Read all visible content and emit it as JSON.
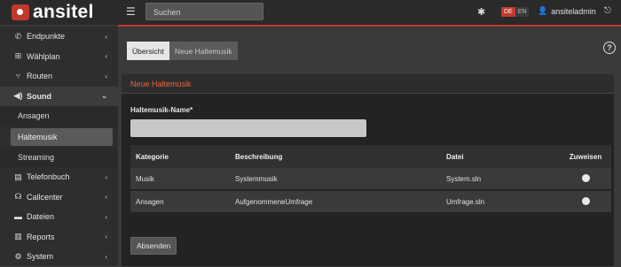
{
  "header": {
    "brand": "ansitel",
    "search_placeholder": "Suchen",
    "lang_de": "DE",
    "lang_en": "EN",
    "username": "ansiteladmin"
  },
  "sidebar": {
    "items": [
      {
        "label": "Endpunkte",
        "icon": "phone-icon"
      },
      {
        "label": "Wählplan",
        "icon": "sitemap-icon"
      },
      {
        "label": "Routen",
        "icon": "route-icon"
      },
      {
        "label": "Sound",
        "icon": "volume-icon"
      },
      {
        "label": "Telefonbuch",
        "icon": "addressbook-icon"
      },
      {
        "label": "Callcenter",
        "icon": "headset-icon"
      },
      {
        "label": "Dateien",
        "icon": "folder-icon"
      },
      {
        "label": "Reports",
        "icon": "chart-icon"
      },
      {
        "label": "System",
        "icon": "cogs-icon"
      }
    ],
    "sound_sub": [
      "Ansagen",
      "Haltemusik",
      "Streaming"
    ]
  },
  "main": {
    "tabs": [
      "Übersicht",
      "Neue Haltemusik"
    ],
    "panel_title": "Neue Haltemusik",
    "field_label": "Haltemusik-Name*",
    "table": {
      "headers": [
        "Kategorie",
        "Beschreibung",
        "Datei",
        "Zuweisen"
      ],
      "rows": [
        [
          "Musik",
          "Systemmusik",
          "System.sln"
        ],
        [
          "Ansagen",
          "AufgenommeneUmfrage",
          "Umfrage.sln"
        ]
      ]
    },
    "submit_label": "Absenden"
  },
  "colors": {
    "accent": "#c0392b",
    "panel_title": "#e8663c"
  }
}
